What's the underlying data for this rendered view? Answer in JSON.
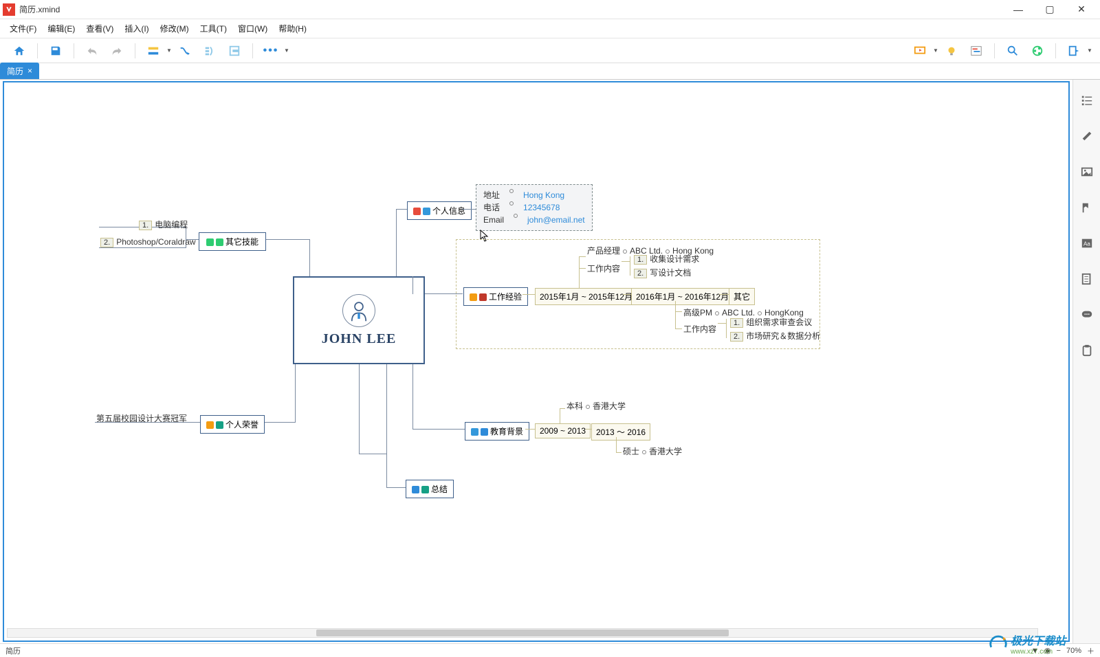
{
  "window": {
    "title": "简历.xmind"
  },
  "menu": {
    "file": "文件(F)",
    "edit": "编辑(E)",
    "view": "查看(V)",
    "insert": "插入(I)",
    "modify": "修改(M)",
    "tools": "工具(T)",
    "window": "窗口(W)",
    "help": "帮助(H)"
  },
  "tab": {
    "name": "简历"
  },
  "status": {
    "sheet": "简历",
    "zoom": "70%"
  },
  "root": {
    "name": "JOHN LEE"
  },
  "branches": {
    "skills": {
      "title": "其它技能",
      "items": [
        "电脑编程",
        "Photoshop/Coraldraw"
      ]
    },
    "honors": {
      "title": "个人荣誉",
      "items": [
        "第五届校园设计大赛冠军"
      ]
    },
    "profile": {
      "title": "个人信息",
      "rows": [
        {
          "k": "地址",
          "v": "Hong Kong"
        },
        {
          "k": "电话",
          "v": "12345678"
        },
        {
          "k": "Email",
          "v": "john@email.net"
        }
      ]
    },
    "work": {
      "title": "工作经验",
      "periods": [
        "2015年1月 ~ 2015年12月",
        "2016年1月 ~ 2016年12月",
        "其它"
      ],
      "p1": {
        "role": "产品经理",
        "company": "ABC Ltd.",
        "location": "Hong Kong",
        "tasks_label": "工作内容",
        "tasks": [
          "收集设计需求",
          "写设计文档"
        ]
      },
      "p2": {
        "role": "高级PM",
        "company": "ABC Ltd.",
        "location": "HongKong",
        "tasks_label": "工作内容",
        "tasks": [
          "组织需求审查会议",
          "市场研究＆数据分析"
        ]
      }
    },
    "edu": {
      "title": "教育背景",
      "periods": [
        "2009 ~ 2013",
        "2013 ～ 2016"
      ],
      "p1": {
        "degree": "本科",
        "school": "香港大学"
      },
      "p2": {
        "degree": "硕士",
        "school": "香港大学"
      }
    },
    "summary": {
      "title": "总结"
    }
  },
  "watermark": {
    "brand": "极光下载站",
    "url": "www.xz7.com"
  }
}
